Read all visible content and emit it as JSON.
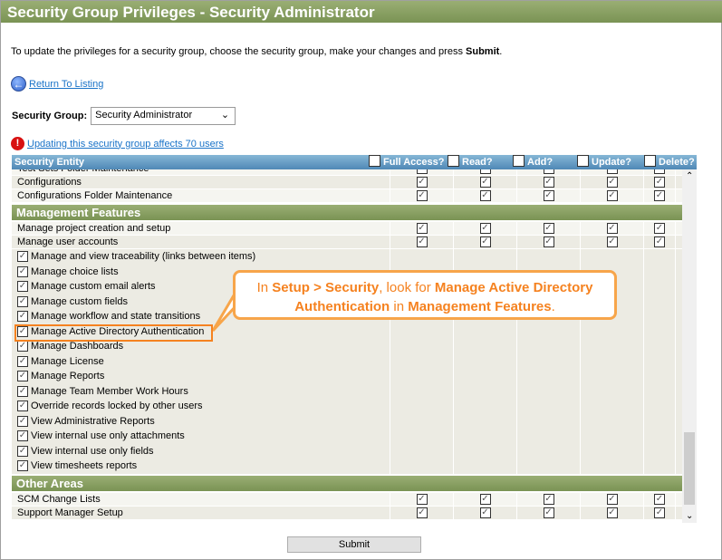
{
  "title": "Security Group Privileges - Security Administrator",
  "intro": {
    "text": "To update the privileges for a security group, choose the security group, make your changes and press ",
    "bold": "Submit",
    "end": "."
  },
  "return_link": "Return To Listing",
  "security_group": {
    "label": "Security Group:",
    "value": "Security Administrator"
  },
  "warning_link": "Updating this security group affects 70 users",
  "columns": {
    "entity": "Security Entity",
    "full": "Full Access?",
    "read": "Read?",
    "add": "Add?",
    "update": "Update?",
    "delete": "Delete?"
  },
  "rows_top": [
    "Test Sets Folder Maintenance",
    "Configurations",
    "Configurations Folder Maintenance"
  ],
  "sections": {
    "mgmt": "Management Features",
    "other": "Other Areas"
  },
  "mgmt_rows": [
    "Manage project creation and setup",
    "Manage user accounts"
  ],
  "mgmt_checks": [
    "Manage and view traceability (links between items)",
    "Manage choice lists",
    "Manage custom email alerts",
    "Manage custom fields",
    "Manage workflow and state transitions",
    "Manage Active Directory Authentication",
    "Manage Dashboards",
    "Manage License",
    "Manage Reports",
    "Manage Team Member Work Hours",
    "Override records locked by other users",
    "View Administrative Reports",
    "View internal use only attachments",
    "View internal use only fields",
    "View timesheets reports"
  ],
  "other_rows": [
    "SCM Change Lists",
    "Support Manager Setup"
  ],
  "callout": {
    "p1": "In ",
    "b1": "Setup > Security",
    "p2": ", look for ",
    "b2": "Manage Active Directory Authentication",
    "p3": " in ",
    "b3": "Management Features",
    "p4": "."
  },
  "submit": "Submit",
  "colors": {
    "accent_green": "#7a9354",
    "header_blue": "#4f88b6",
    "callout_orange": "#f58220"
  }
}
